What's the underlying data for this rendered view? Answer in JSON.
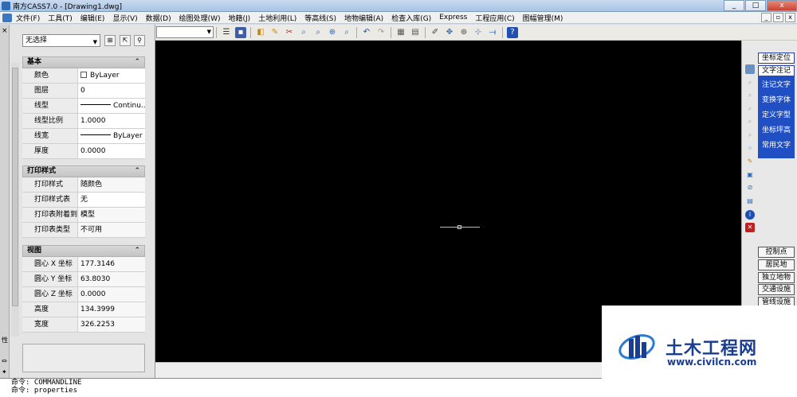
{
  "window": {
    "title": "南方CASS7.0 - [Drawing1.dwg]",
    "min": "_",
    "max": "□",
    "close": "x"
  },
  "menu": [
    "文件(F)",
    "工具(T)",
    "编辑(E)",
    "显示(V)",
    "数据(D)",
    "绘图处理(W)",
    "地籍(J)",
    "土地利用(L)",
    "等高线(S)",
    "地物编辑(A)",
    "检查入库(G)",
    "Express",
    "工程应用(C)",
    "图幅管理(M)"
  ],
  "doc_buttons": {
    "min": "_",
    "restore": "▫",
    "close": "x"
  },
  "palette": {
    "close": "×",
    "side_label": "性",
    "selection": "无选择",
    "sections": {
      "basic": {
        "title": "基本",
        "collapse": "⌃",
        "rows": [
          {
            "name": "颜色",
            "value": "ByLayer"
          },
          {
            "name": "图层",
            "value": "0"
          },
          {
            "name": "线型",
            "value": "Continu..."
          },
          {
            "name": "线型比例",
            "value": "1.0000"
          },
          {
            "name": "线宽",
            "value": "ByLayer"
          },
          {
            "name": "厚度",
            "value": "0.0000"
          }
        ]
      },
      "print": {
        "title": "打印样式",
        "collapse": "⌃",
        "rows": [
          {
            "name": "打印样式",
            "value": "随颜色"
          },
          {
            "name": "打印样式表",
            "value": "无"
          },
          {
            "name": "打印表附着到",
            "value": "模型"
          },
          {
            "name": "打印表类型",
            "value": "不可用"
          }
        ]
      },
      "view": {
        "title": "视图",
        "collapse": "⌃",
        "rows": [
          {
            "name": "圆心 X 坐标",
            "value": "177.3146"
          },
          {
            "name": "圆心 Y 坐标",
            "value": "63.8030"
          },
          {
            "name": "圆心 Z 坐标",
            "value": "0.0000"
          },
          {
            "name": "高度",
            "value": "134.3999"
          },
          {
            "name": "宽度",
            "value": "326.2253"
          }
        ]
      }
    }
  },
  "right_panel": {
    "top_buttons": [
      "坐标定位",
      "文字注记"
    ],
    "blue_items": [
      "注记文字",
      "变换字体",
      "定义字型",
      "坐标坪高",
      "常用文字"
    ],
    "list_items": [
      "控制点",
      "居民地",
      "独立地物",
      "交通设施",
      "管线设施"
    ]
  },
  "command": {
    "lines": [
      "命令: COMMANDLINE",
      "命令: properties"
    ]
  },
  "watermark": {
    "title": "土木工程网",
    "url": "www.civilcn.com"
  }
}
